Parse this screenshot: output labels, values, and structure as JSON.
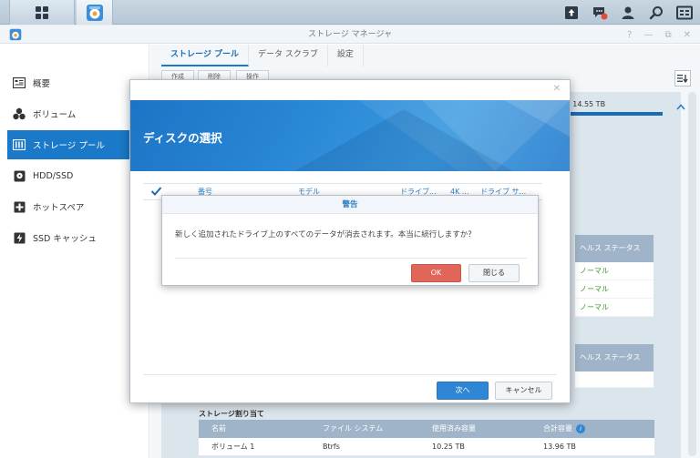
{
  "window": {
    "title": "ストレージ マネージャ",
    "controls": [
      "?",
      "—",
      "⧉",
      "✕"
    ]
  },
  "sidebar": {
    "items": [
      {
        "label": "概要",
        "icon": "overview-icon"
      },
      {
        "label": "ボリューム",
        "icon": "volume-icon"
      },
      {
        "label": "ストレージ プール",
        "icon": "storage-pool-icon",
        "active": true
      },
      {
        "label": "HDD/SSD",
        "icon": "hdd-icon"
      },
      {
        "label": "ホットスペア",
        "icon": "hot-spare-icon"
      },
      {
        "label": "SSD キャッシュ",
        "icon": "ssd-cache-icon"
      }
    ]
  },
  "tabs": [
    {
      "label": "ストレージ プール",
      "active": true
    },
    {
      "label": "データ スクラブ"
    },
    {
      "label": "設定"
    }
  ],
  "toolbar": {
    "buttons": [
      "作成",
      "削除",
      "操作"
    ]
  },
  "pool": {
    "capacity": "/ 14.55 TB"
  },
  "health": {
    "header": "ヘルス ステータス",
    "values": [
      "ノーマル",
      "ノーマル",
      "ノーマル"
    ],
    "header2": "ヘルス ステータス"
  },
  "allocation": {
    "title": "ストレージ割り当て",
    "columns": [
      "名前",
      "ファイル システム",
      "使用済み容量",
      "合計容量"
    ],
    "rows": [
      {
        "name": "ボリューム 1",
        "fs": "Btrfs",
        "used": "10.25 TB",
        "total": "13.96 TB"
      }
    ]
  },
  "modal": {
    "title": "ディスクの選択",
    "columns": [
      "番号",
      "モデル",
      "ドライブ...",
      "4K ...",
      "ドライブ サ..."
    ],
    "next_label": "次へ",
    "cancel_label": "キャンセル"
  },
  "warning": {
    "title": "警告",
    "message": "新しく追加されたドライブ上のすべてのデータが消去されます。本当に続行しますか？",
    "ok_label": "OK",
    "close_label": "閉じる"
  },
  "colors": {
    "accent": "#1a79c8",
    "banner": "#2a88d6",
    "danger": "#e0665a",
    "health_ok": "#3a9a2b"
  }
}
